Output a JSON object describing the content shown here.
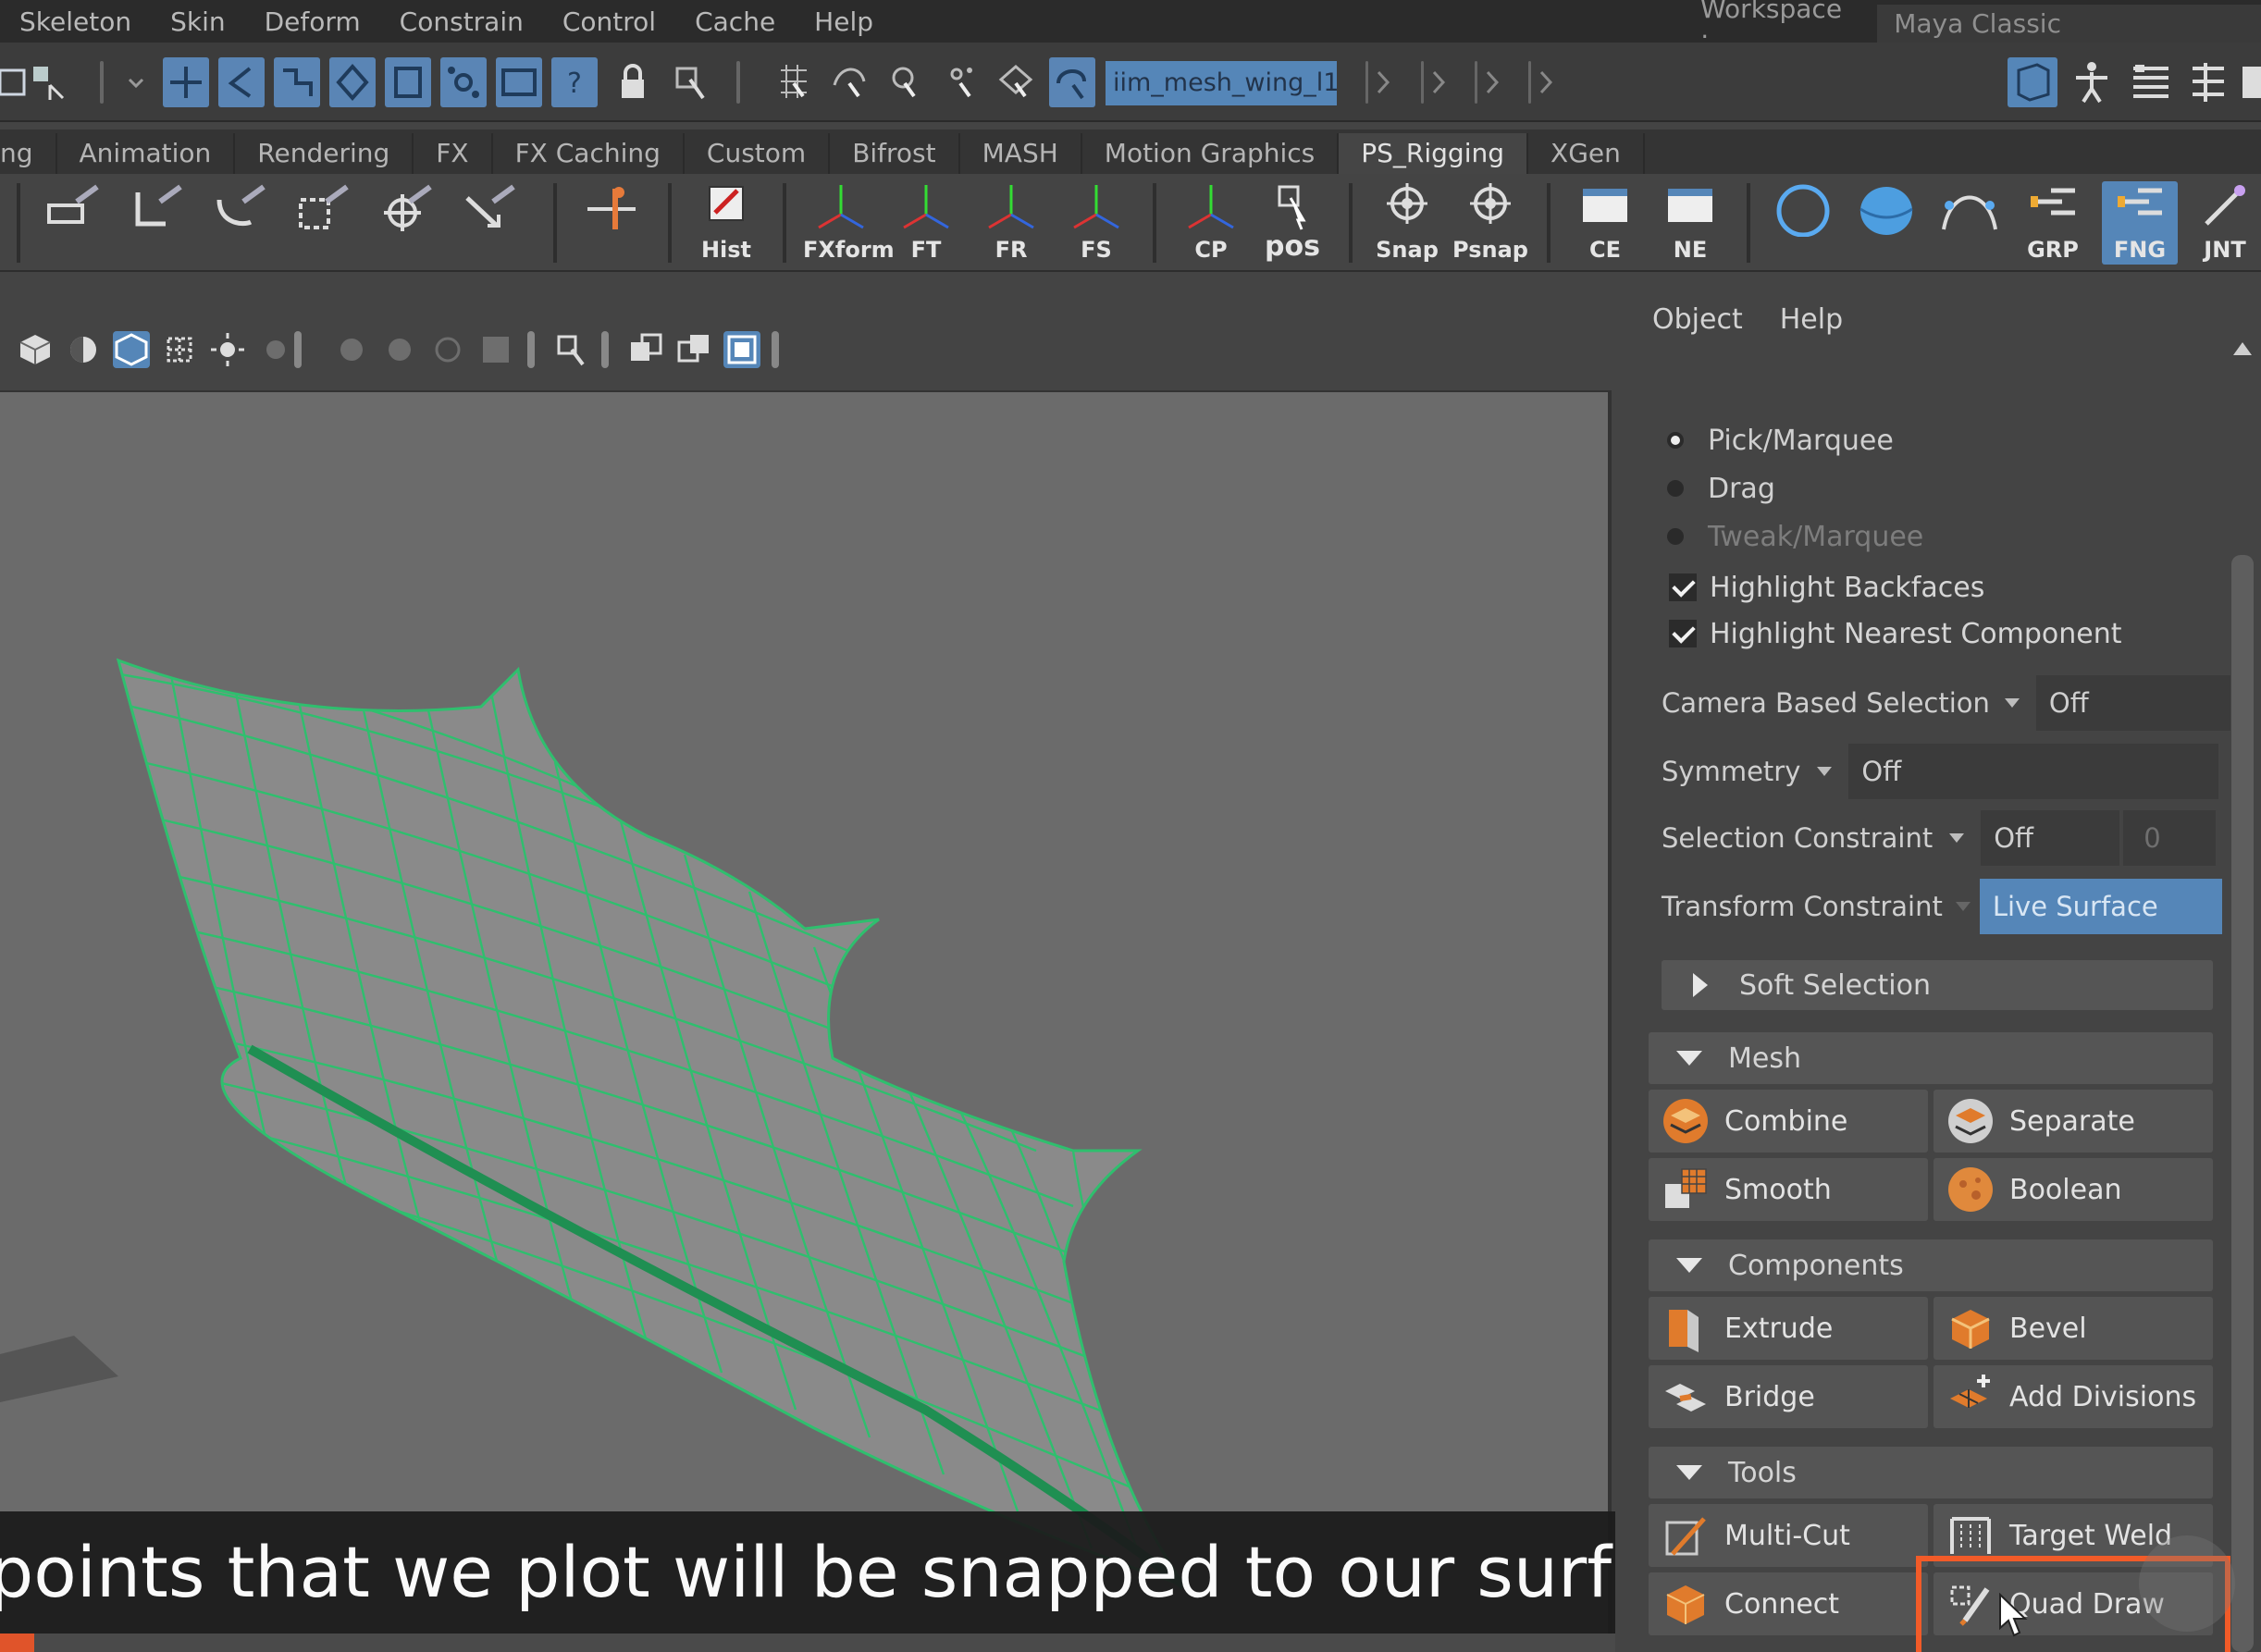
{
  "menubar": {
    "items": [
      "Skeleton",
      "Skin",
      "Deform",
      "Constrain",
      "Control",
      "Cache",
      "Help"
    ],
    "workspace_label": "Workspace :",
    "workspace_value": "Maya Classic"
  },
  "status": {
    "object_name": "iim_mesh_wing_l1"
  },
  "shelf_tabs": {
    "items": [
      "ng",
      "Animation",
      "Rendering",
      "FX",
      "FX Caching",
      "Custom",
      "Bifrost",
      "MASH",
      "Motion Graphics",
      "PS_Rigging",
      "XGen"
    ],
    "active": "PS_Rigging"
  },
  "shelf": {
    "hist": "Hist",
    "fxform": "FXform",
    "ft": "FT",
    "fr": "FR",
    "fs": "FS",
    "cp": "CP",
    "pos": "pos",
    "snap": "Snap",
    "psnap": "Psnap",
    "ce": "CE",
    "ne": "NE",
    "grp": "GRP",
    "fng": "FNG",
    "jnt": "JNT"
  },
  "panel": {
    "menu": [
      "Object",
      "Help"
    ],
    "radios": {
      "pick": "Pick/Marquee",
      "drag": "Drag",
      "tweak": "Tweak/Marquee"
    },
    "checks": {
      "backfaces": "Highlight Backfaces",
      "nearest": "Highlight Nearest Component"
    },
    "camera_based": {
      "label": "Camera Based Selection",
      "value": "Off"
    },
    "symmetry": {
      "label": "Symmetry",
      "value": "Off"
    },
    "selection_constraint": {
      "label": "Selection Constraint",
      "value": "Off",
      "num": "0"
    },
    "transform_constraint": {
      "label": "Transform Constraint",
      "value": "Live Surface"
    },
    "soft_selection": "Soft Selection",
    "mesh": {
      "title": "Mesh",
      "combine": "Combine",
      "separate": "Separate",
      "smooth": "Smooth",
      "boolean": "Boolean"
    },
    "components": {
      "title": "Components",
      "extrude": "Extrude",
      "bevel": "Bevel",
      "bridge": "Bridge",
      "add_divisions": "Add Divisions"
    },
    "tools": {
      "title": "Tools",
      "multicut": "Multi-Cut",
      "target_weld": "Target Weld",
      "connect": "Connect",
      "quad_draw": "Quad Draw"
    }
  },
  "subtitle": "points that we plot will be snapped to our surface.",
  "video_progress": 0.015,
  "colors": {
    "accent_blue": "#5586b8",
    "mesh_wire": "#2fbf6e",
    "highlight": "#f25b28"
  }
}
